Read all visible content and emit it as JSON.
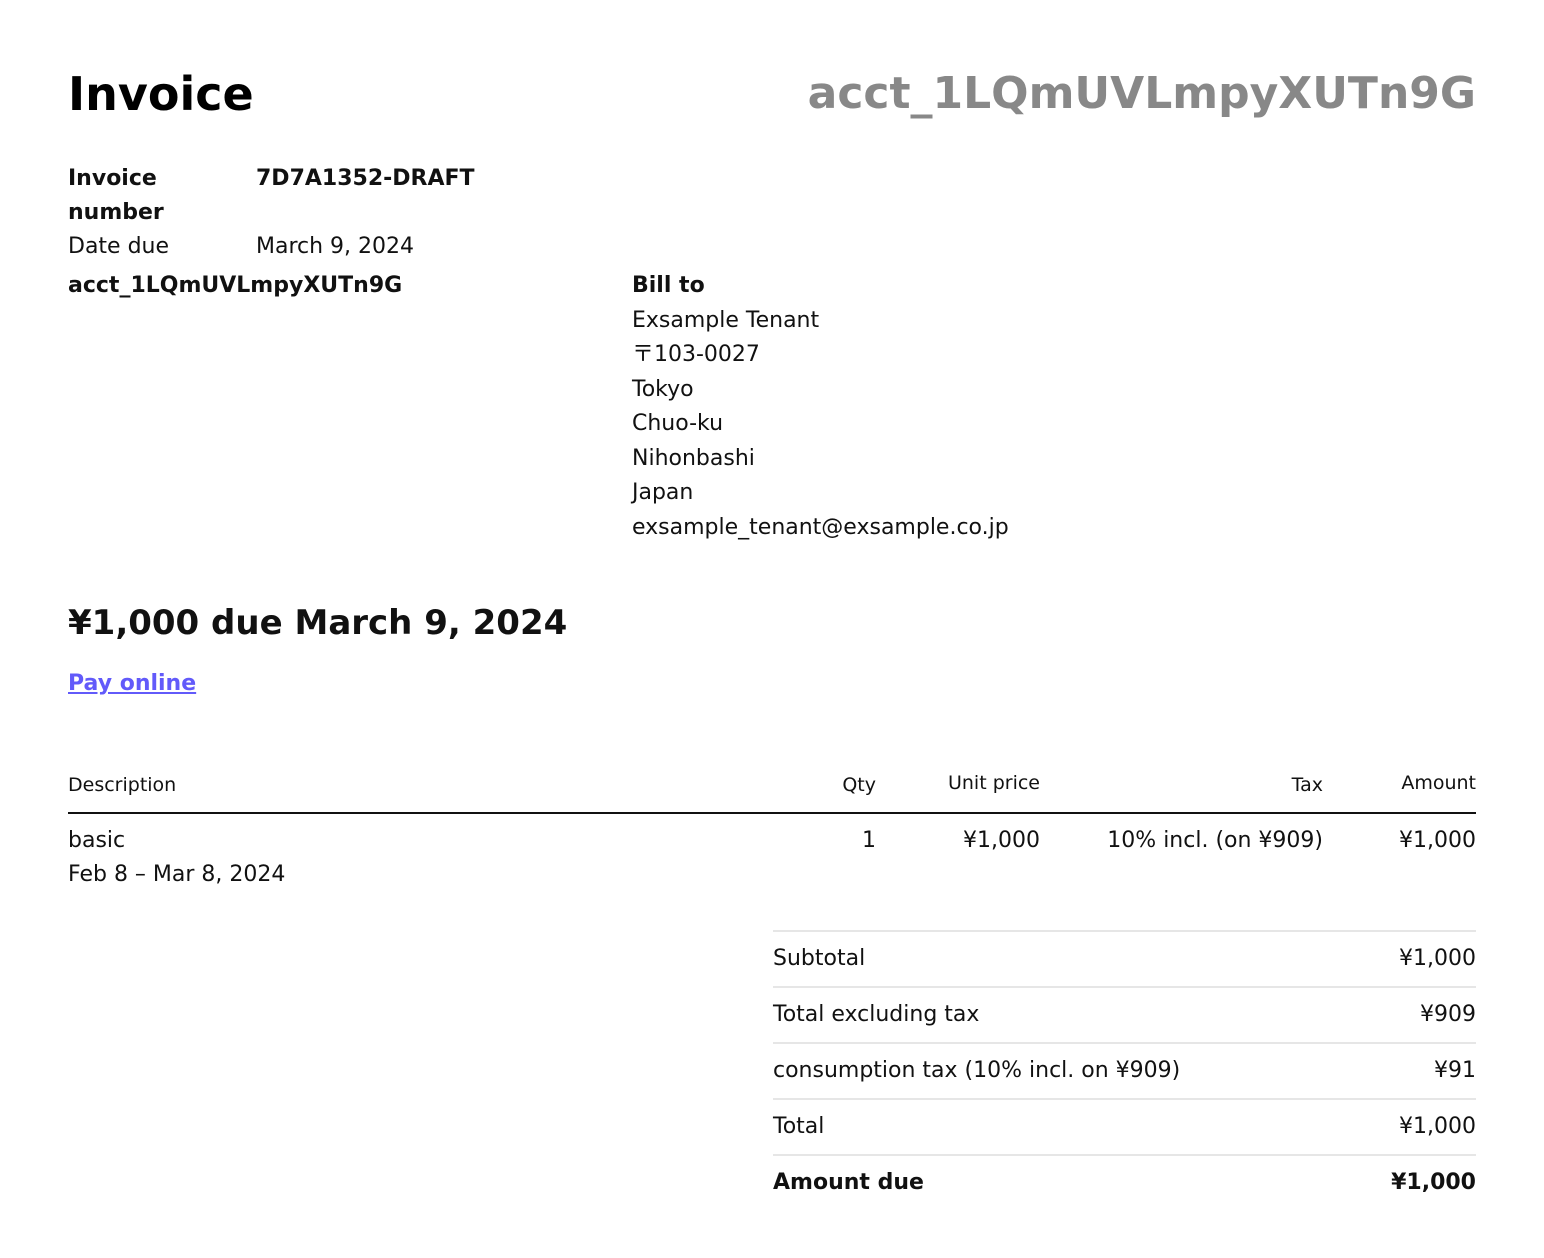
{
  "header": {
    "title": "Invoice",
    "account": "acct_1LQmUVLmpyXUTn9G"
  },
  "meta": {
    "invoice_number_label": "Invoice number",
    "invoice_number": "7D7A1352-DRAFT",
    "date_due_label": "Date due",
    "date_due": "March 9, 2024"
  },
  "from": {
    "account": "acct_1LQmUVLmpyXUTn9G"
  },
  "bill_to": {
    "title": "Bill to",
    "lines": [
      "Exsample Tenant",
      "〒103-0027",
      "Tokyo",
      "Chuo-ku",
      "Nihonbashi",
      "Japan",
      "exsample_tenant@exsample.co.jp"
    ]
  },
  "due_heading": "¥1,000 due March 9, 2024",
  "pay_online": "Pay online",
  "colors": {
    "link": "#625afa",
    "muted": "#888888"
  },
  "items": {
    "headers": {
      "description": "Description",
      "qty": "Qty",
      "unit_price": "Unit price",
      "tax": "Tax",
      "amount": "Amount"
    },
    "rows": [
      {
        "description": "basic",
        "period": "Feb 8 – Mar 8, 2024",
        "qty": "1",
        "unit_price": "¥1,000",
        "tax": "10% incl. (on ¥909)",
        "amount": "¥1,000"
      }
    ]
  },
  "totals": [
    {
      "label": "Subtotal",
      "value": "¥1,000"
    },
    {
      "label": "Total excluding tax",
      "value": "¥909"
    },
    {
      "label": "consumption tax (10% incl. on ¥909)",
      "value": "¥91"
    },
    {
      "label": "Total",
      "value": "¥1,000"
    },
    {
      "label": "Amount due",
      "value": "¥1,000"
    }
  ]
}
